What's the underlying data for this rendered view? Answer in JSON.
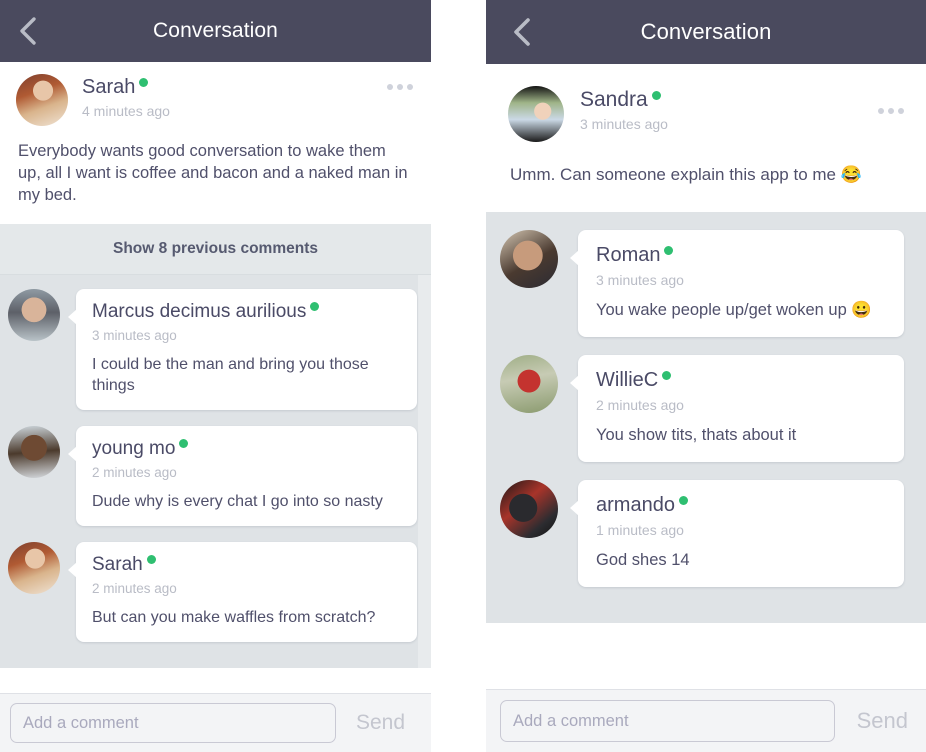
{
  "colors": {
    "header_bg": "#4a4a5e",
    "online_green": "#2fbf71",
    "comments_bg": "#dfe3e6",
    "text_primary": "#50506b",
    "text_muted": "#b9bcc6"
  },
  "left_panel": {
    "header": {
      "title": "Conversation",
      "back_icon": "chevron-left-icon"
    },
    "post": {
      "author": "Sarah",
      "online": true,
      "timestamp": "4 minutes ago",
      "avatar": "av-sarah",
      "menu_icon": "more-options-icon",
      "body": "Everybody wants good conversation to wake them up, all I want is coffee and bacon and a naked man in my bed."
    },
    "show_previous_label": "Show 8 previous comments",
    "comments": [
      {
        "author": "Marcus decimus aurilious",
        "online": true,
        "timestamp": "3 minutes ago",
        "text": "I could be the man and bring you those things",
        "avatar": "av-marcus"
      },
      {
        "author": "young mo",
        "online": true,
        "timestamp": "2 minutes ago",
        "text": "Dude why is every chat I go into so nasty",
        "avatar": "av-youngmo"
      },
      {
        "author": "Sarah",
        "online": true,
        "timestamp": "2 minutes ago",
        "text": "But can you make waffles from scratch?",
        "avatar": "av-sarah"
      }
    ],
    "composer": {
      "placeholder": "Add a comment",
      "value": "",
      "send_label": "Send"
    }
  },
  "right_panel": {
    "header": {
      "title": "Conversation",
      "back_icon": "chevron-left-icon"
    },
    "post": {
      "author": "Sandra",
      "online": true,
      "timestamp": "3 minutes ago",
      "avatar": "av-sandra",
      "menu_icon": "more-options-icon",
      "body": "Umm. Can someone explain this app to me 😂"
    },
    "comments": [
      {
        "author": "Roman",
        "online": true,
        "timestamp": "3 minutes ago",
        "text": "You wake people up/get woken up 😀",
        "avatar": "av-roman"
      },
      {
        "author": "WillieC",
        "online": true,
        "timestamp": "2 minutes ago",
        "text": "You show tits, thats about it",
        "avatar": "av-willie"
      },
      {
        "author": "armando",
        "online": true,
        "timestamp": "1 minutes ago",
        "text": "God shes 14",
        "avatar": "av-armando"
      }
    ],
    "composer": {
      "placeholder": "Add a comment",
      "value": "",
      "send_label": "Send"
    }
  }
}
